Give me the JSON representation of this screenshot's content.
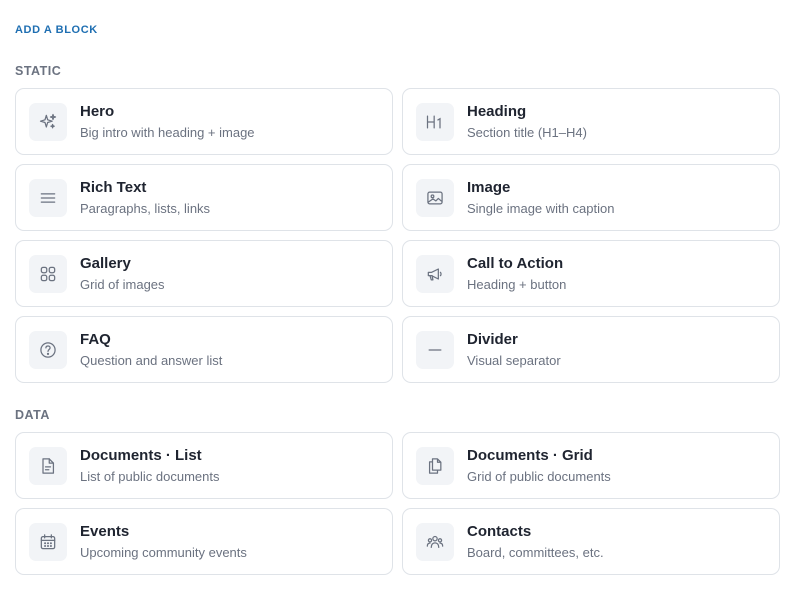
{
  "panel": {
    "title": "ADD A BLOCK"
  },
  "sections": {
    "static": {
      "label": "STATIC",
      "blocks": [
        {
          "title": "Hero",
          "description": "Big intro with heading + image",
          "icon": "sparkles-icon"
        },
        {
          "title": "Heading",
          "description": "Section title (H1–H4)",
          "icon": "heading-icon"
        },
        {
          "title": "Rich Text",
          "description": "Paragraphs, lists, links",
          "icon": "text-lines-icon"
        },
        {
          "title": "Image",
          "description": "Single image with caption",
          "icon": "image-icon"
        },
        {
          "title": "Gallery",
          "description": "Grid of images",
          "icon": "grid-icon"
        },
        {
          "title": "Call to Action",
          "description": "Heading + button",
          "icon": "megaphone-icon"
        },
        {
          "title": "FAQ",
          "description": "Question and answer list",
          "icon": "question-circle-icon"
        },
        {
          "title": "Divider",
          "description": "Visual separator",
          "icon": "divider-icon"
        }
      ]
    },
    "data": {
      "label": "DATA",
      "blocks": [
        {
          "title": "Documents · List",
          "description": "List of public documents",
          "icon": "document-icon"
        },
        {
          "title": "Documents · Grid",
          "description": "Grid of public documents",
          "icon": "documents-stack-icon"
        },
        {
          "title": "Events",
          "description": "Upcoming community events",
          "icon": "calendar-icon"
        },
        {
          "title": "Contacts",
          "description": "Board, committees, etc.",
          "icon": "people-icon"
        }
      ]
    }
  }
}
